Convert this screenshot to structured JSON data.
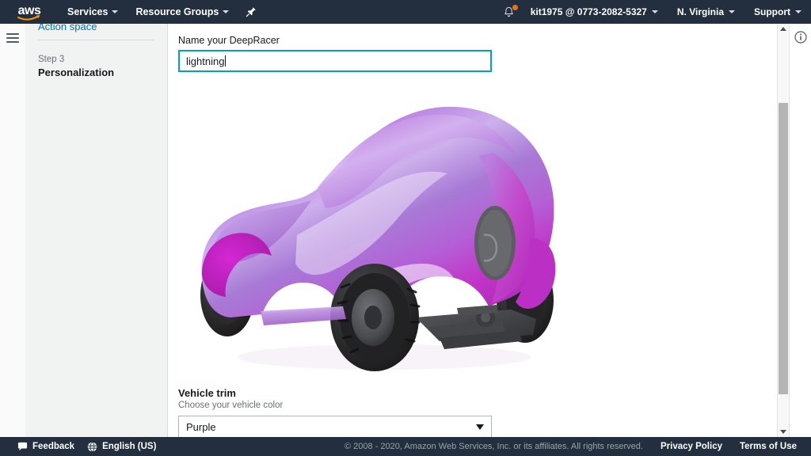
{
  "topnav": {
    "logo_text": "aws",
    "services_label": "Services",
    "resource_groups_label": "Resource Groups",
    "pin_icon": "pin-icon",
    "bell_icon": "notification-bell-icon",
    "account_label": "kit1975 @ 0773-2082-5327",
    "region_label": "N. Virginia",
    "support_label": "Support"
  },
  "sidebar": {
    "previous_step_link": "Action space",
    "step_number": "Step 3",
    "step_title": "Personalization"
  },
  "main": {
    "name_label": "Name your DeepRacer",
    "name_value": "lightning",
    "trim_title": "Vehicle trim",
    "trim_subtitle": "Choose your vehicle color",
    "trim_selected": "Purple",
    "trim_options": [
      "Purple"
    ],
    "car_colors": {
      "body_light": "#c9a6e8",
      "body_mid": "#a97fd6",
      "body_magenta": "#c02fc6",
      "body_deep": "#8d5fc0",
      "highlight": "#f0e4fa",
      "tire": "#2b2b2d",
      "rim": "#57585c",
      "chassis": "#3c3e42"
    }
  },
  "scrollbar": {
    "up_arrow": "scroll-up-arrow-icon",
    "down_arrow": "scroll-down-arrow-icon"
  },
  "info_panel": {
    "info_icon": "info-circle-icon"
  },
  "footer": {
    "feedback_label": "Feedback",
    "language_label": "English (US)",
    "copyright": "© 2008 - 2020, Amazon Web Services, Inc. or its affiliates. All rights reserved.",
    "privacy_label": "Privacy Policy",
    "terms_label": "Terms of Use"
  },
  "colors": {
    "nav_bg": "#232f3e",
    "accent_blue": "#00a1c9",
    "link_blue": "#0073bb",
    "orange": "#ec7211"
  }
}
